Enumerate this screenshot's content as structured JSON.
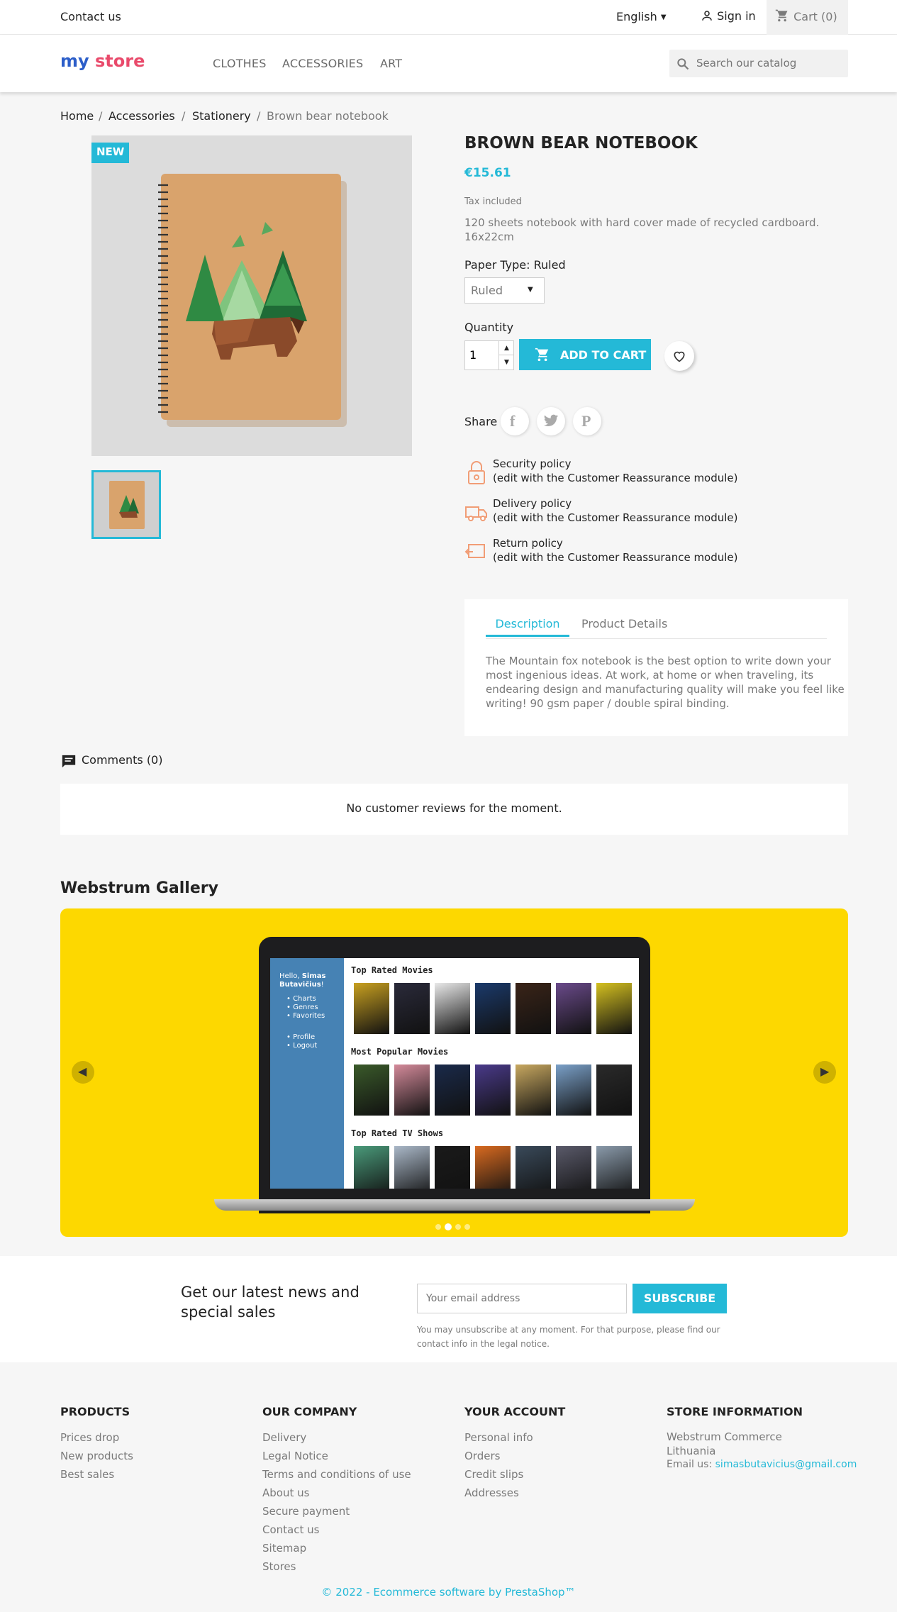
{
  "topbar": {
    "contact": "Contact us",
    "language": "English",
    "signin": "Sign in",
    "cart": "Cart",
    "cart_count": "(0)"
  },
  "header": {
    "logo_my": "my",
    "logo_store": "store",
    "nav": [
      "CLOTHES",
      "ACCESSORIES",
      "ART"
    ],
    "search_placeholder": "Search our catalog"
  },
  "breadcrumb": [
    "Home",
    "Accessories",
    "Stationery",
    "Brown bear notebook"
  ],
  "product": {
    "badge": "NEW",
    "title": "BROWN BEAR NOTEBOOK",
    "price": "€15.61",
    "tax": "Tax included",
    "desc_line1": "120 sheets notebook with hard cover made of recycled cardboard.",
    "desc_line2": "16x22cm",
    "variant_label": "Paper Type: Ruled",
    "variant_value": "Ruled",
    "quantity_label": "Quantity",
    "quantity_value": "1",
    "add_to_cart": "ADD TO CART",
    "share_label": "Share"
  },
  "reassurance": [
    {
      "title": "Security policy",
      "sub": "(edit with the Customer Reassurance module)"
    },
    {
      "title": "Delivery policy",
      "sub": "(edit with the Customer Reassurance module)"
    },
    {
      "title": "Return policy",
      "sub": "(edit with the Customer Reassurance module)"
    }
  ],
  "tabs": {
    "items": [
      "Description",
      "Product Details"
    ],
    "active": "Description",
    "description_lines": [
      "The Mountain fox notebook is the best option to write down your",
      "most ingenious ideas. At work, at home or when traveling, its",
      "endearing design and manufacturing quality will make you feel like",
      "writing! 90 gsm paper / double spiral binding."
    ]
  },
  "comments": {
    "heading": "Comments (0)",
    "empty": "No customer reviews for the moment."
  },
  "gallery": {
    "title": "Webstrum Gallery",
    "screen": {
      "hello": "Hello,",
      "user": "Simas",
      "user2": "Butavičius",
      "exclaim": "!",
      "menu": [
        "Charts",
        "Genres",
        "Favorites"
      ],
      "menu2": [
        "Profile",
        "Logout"
      ],
      "sections": [
        "Top Rated Movies",
        "Most Popular Movies",
        "Top Rated TV Shows"
      ]
    },
    "active_slide": 2,
    "slide_count": 4
  },
  "newsletter": {
    "heading_line1": "Get our latest news and",
    "heading_line2": "special sales",
    "email_placeholder": "Your email address",
    "subscribe": "SUBSCRIBE",
    "note_line1": "You may unsubscribe at any moment. For that purpose, please find our",
    "note_line2": "contact info in the legal notice."
  },
  "footer": {
    "products": {
      "title": "PRODUCTS",
      "links": [
        "Prices drop",
        "New products",
        "Best sales"
      ]
    },
    "company": {
      "title": "OUR COMPANY",
      "links": [
        "Delivery",
        "Legal Notice",
        "Terms and conditions of use",
        "About us",
        "Secure payment",
        "Contact us",
        "Sitemap",
        "Stores"
      ]
    },
    "account": {
      "title": "YOUR ACCOUNT",
      "links": [
        "Personal info",
        "Orders",
        "Credit slips",
        "Addresses"
      ]
    },
    "store": {
      "title": "STORE INFORMATION",
      "line1": "Webstrum Commerce",
      "line2": "Lithuania",
      "email_label": "Email us:",
      "email": "simasbutavicius@gmail.com"
    },
    "copyright": "© 2022 - Ecommerce software by PrestaShop™"
  },
  "colors": {
    "accent": "#24b9d7",
    "gallery_bg": "#fdd800",
    "screen_sidebar": "#4682b4"
  }
}
